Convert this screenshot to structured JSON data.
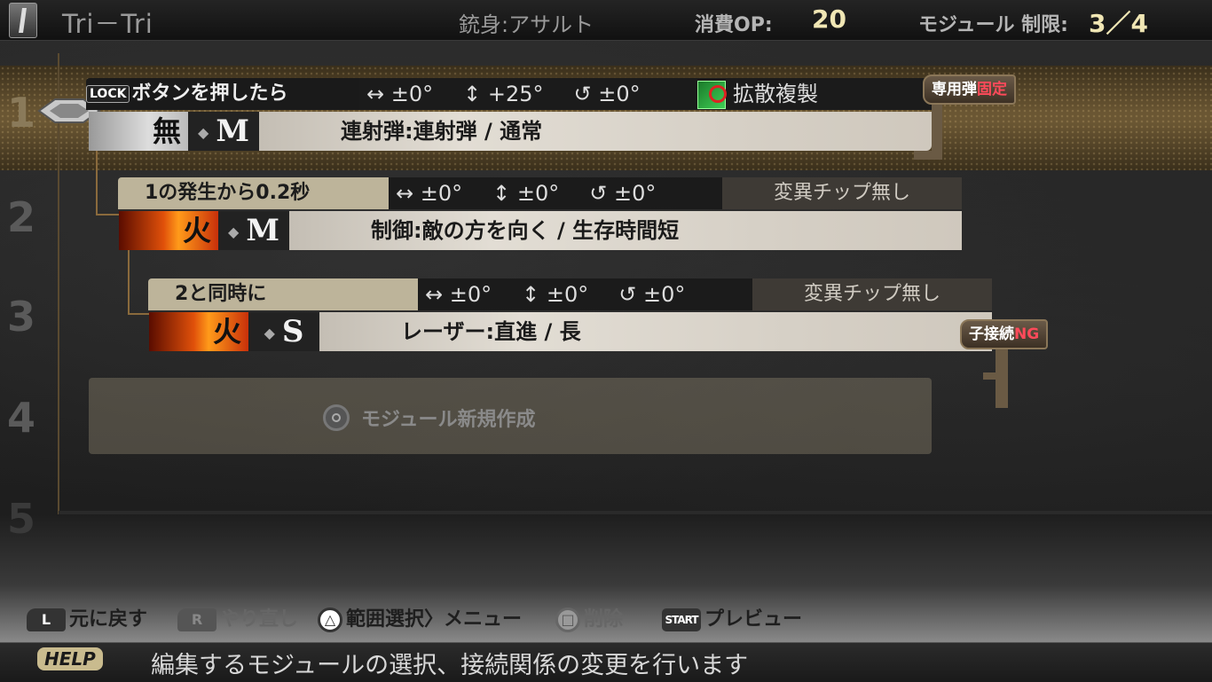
{
  "header": {
    "bullet_name": "Tri－Tri",
    "barrel": "銃身:アサルト",
    "op_label": "消費OP:",
    "op_value": "20",
    "module_limit_label": "モジュール 制限:",
    "module_limit_value": "3／4"
  },
  "rows": {
    "numbers": [
      "1",
      "2",
      "3",
      "4",
      "5"
    ],
    "r1": {
      "lock_key": "LOCK",
      "condition": "ボタンを押したら",
      "horizontal": "↔ ±0°",
      "vertical": "↕ +25°",
      "rotation": "↺ ±0°",
      "chip": "拡散複製",
      "attribute": "無",
      "size": "M",
      "bullet": "連射弾:連射弾 / 通常",
      "tag_text": "専用弾",
      "tag_red": "固定"
    },
    "r2": {
      "condition": "1の発生から0.2秒",
      "horizontal": "↔ ±0°",
      "vertical": "↕ ±0°",
      "rotation": "↺ ±0°",
      "chip": "変異チップ無し",
      "attribute": "火",
      "size": "M",
      "bullet": "制御:敵の方を向く / 生存時間短"
    },
    "r3": {
      "condition": "2と同時に",
      "horizontal": "↔ ±0°",
      "vertical": "↕ ±0°",
      "rotation": "↺ ±0°",
      "chip": "変異チップ無し",
      "attribute": "火",
      "size": "S",
      "bullet": "レーザー:直進 / 長",
      "tag_text": "子接続",
      "tag_red": "NG"
    },
    "r4": {
      "new_module": "モジュール新規作成"
    }
  },
  "controls": {
    "l_key": "L",
    "l_label": "元に戻す",
    "r_key": "R",
    "r_label": "やり直し",
    "triangle_key": "△",
    "triangle_label": "範囲選択〉メニュー",
    "square_key": "□",
    "square_label": "削除",
    "start_key": "START",
    "start_label": "プレビュー"
  },
  "help": {
    "label": "HELP",
    "text": "編集するモジュールの選択、接続関係の変更を行います"
  },
  "colors": {
    "accent_gold": "#f0e6b4",
    "condition_bg": "#bdb49a",
    "ng_red": "#ff4a5a",
    "fire_orange": "#e0500a"
  }
}
